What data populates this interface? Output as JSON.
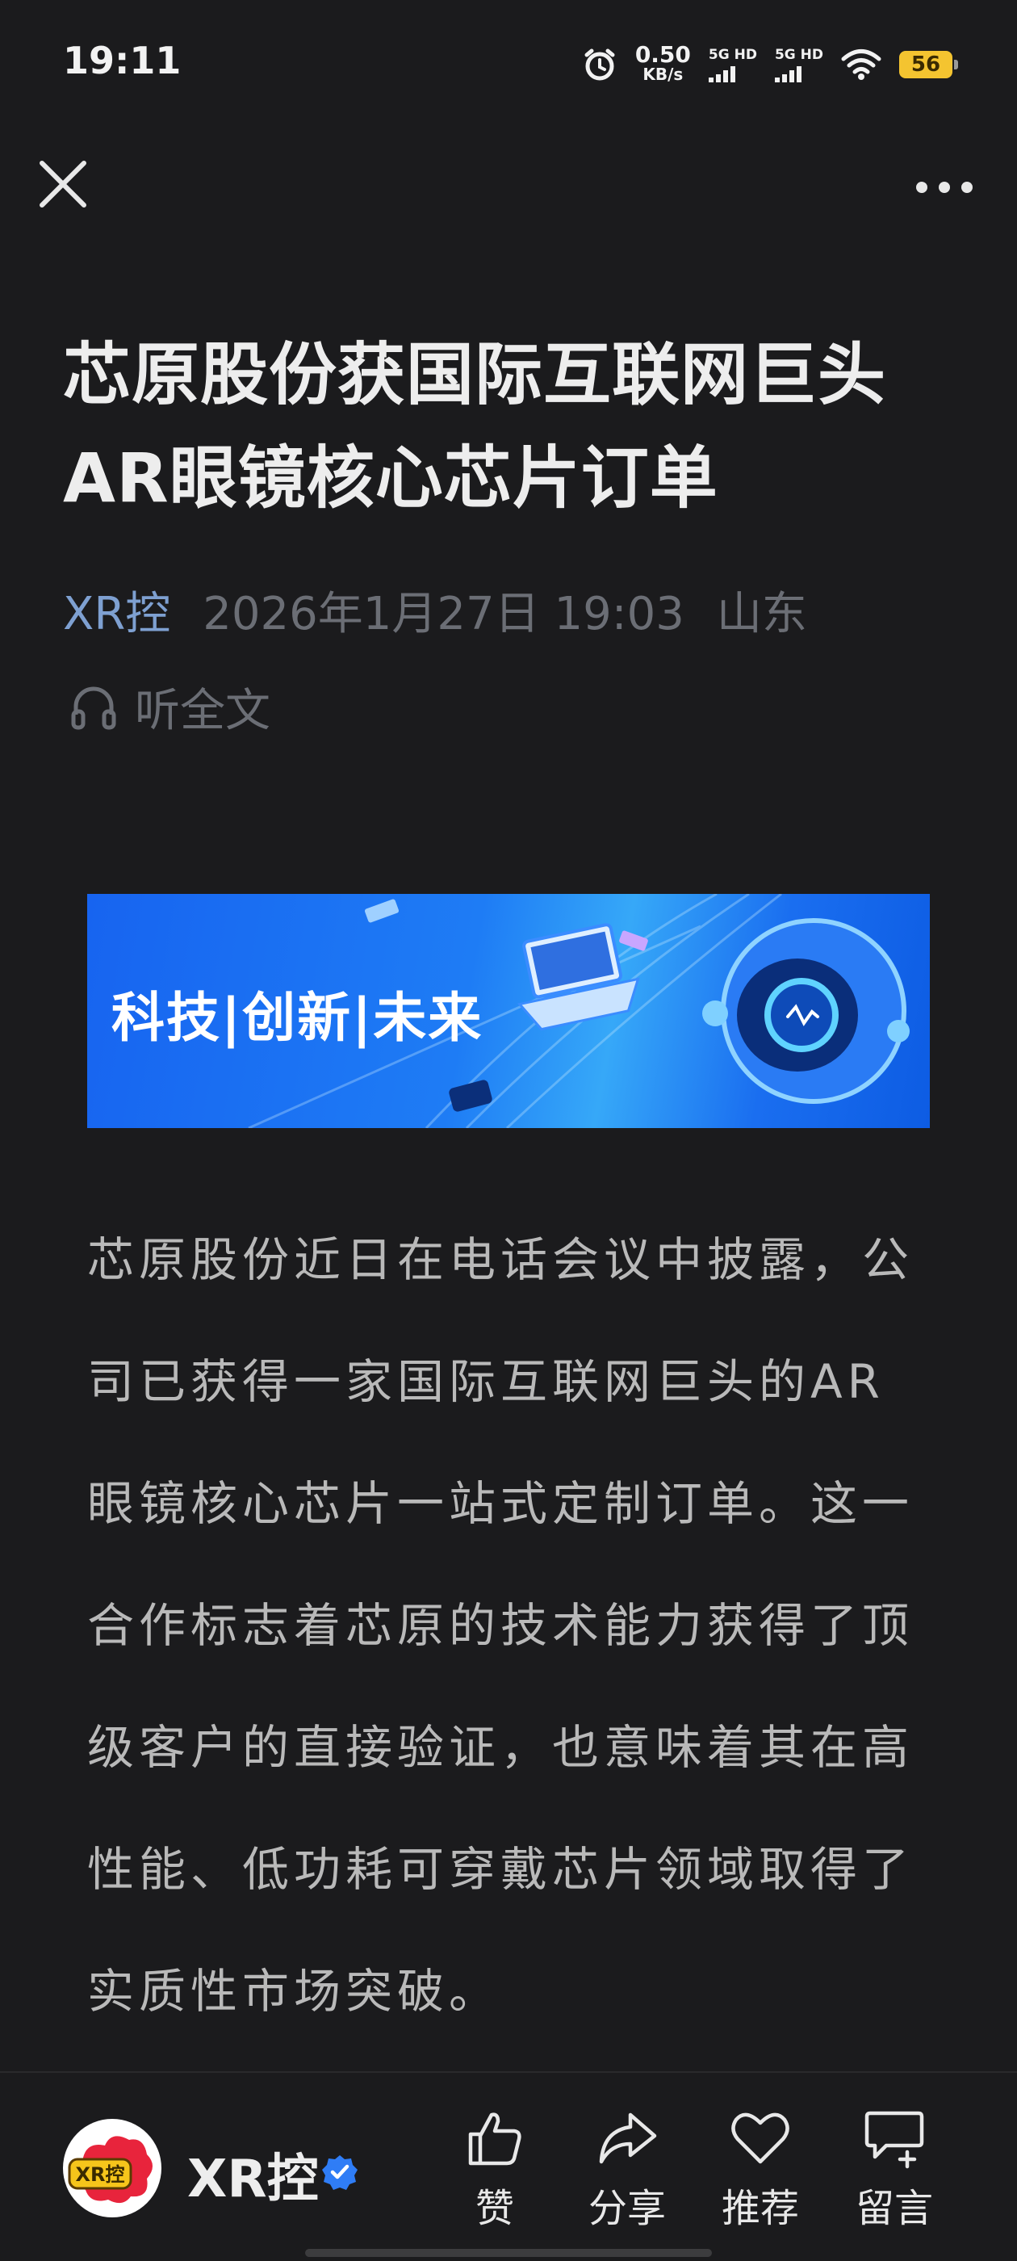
{
  "status_bar": {
    "time": "19:11",
    "net_speed_value": "0.50",
    "net_speed_unit": "KB/s",
    "sim1_label": "5G HD",
    "sim2_label": "5G HD",
    "battery_level": "56"
  },
  "article": {
    "title": "芯原股份获国际互联网巨头AR眼镜核心芯片订单",
    "author": "XR控",
    "date": "2026年1月27日 19:03",
    "location": "山东",
    "listen_label": "听全文",
    "banner_text": "科技|创新|未来",
    "body": "芯原股份近日在电话会议中披露，公司已获得一家国际互联网巨头的AR眼镜核心芯片一站式定制订单。这一合作标志着芯原的技术能力获得了顶级客户的直接验证，也意味着其在高性能、低功耗可穿戴芯片领域取得了实质性市场突破。"
  },
  "bottom_bar": {
    "author_name": "XR控",
    "avatar_text": "XR控",
    "actions": [
      {
        "label": "赞",
        "icon": "thumbs-up-icon"
      },
      {
        "label": "分享",
        "icon": "share-icon"
      },
      {
        "label": "推荐",
        "icon": "heart-icon"
      },
      {
        "label": "留言",
        "icon": "comment-icon"
      }
    ]
  },
  "colors": {
    "background": "#1b1b1d",
    "author_accent": "#7ea0d1",
    "verified_badge": "#2f7df6",
    "battery": "#f4c430"
  }
}
